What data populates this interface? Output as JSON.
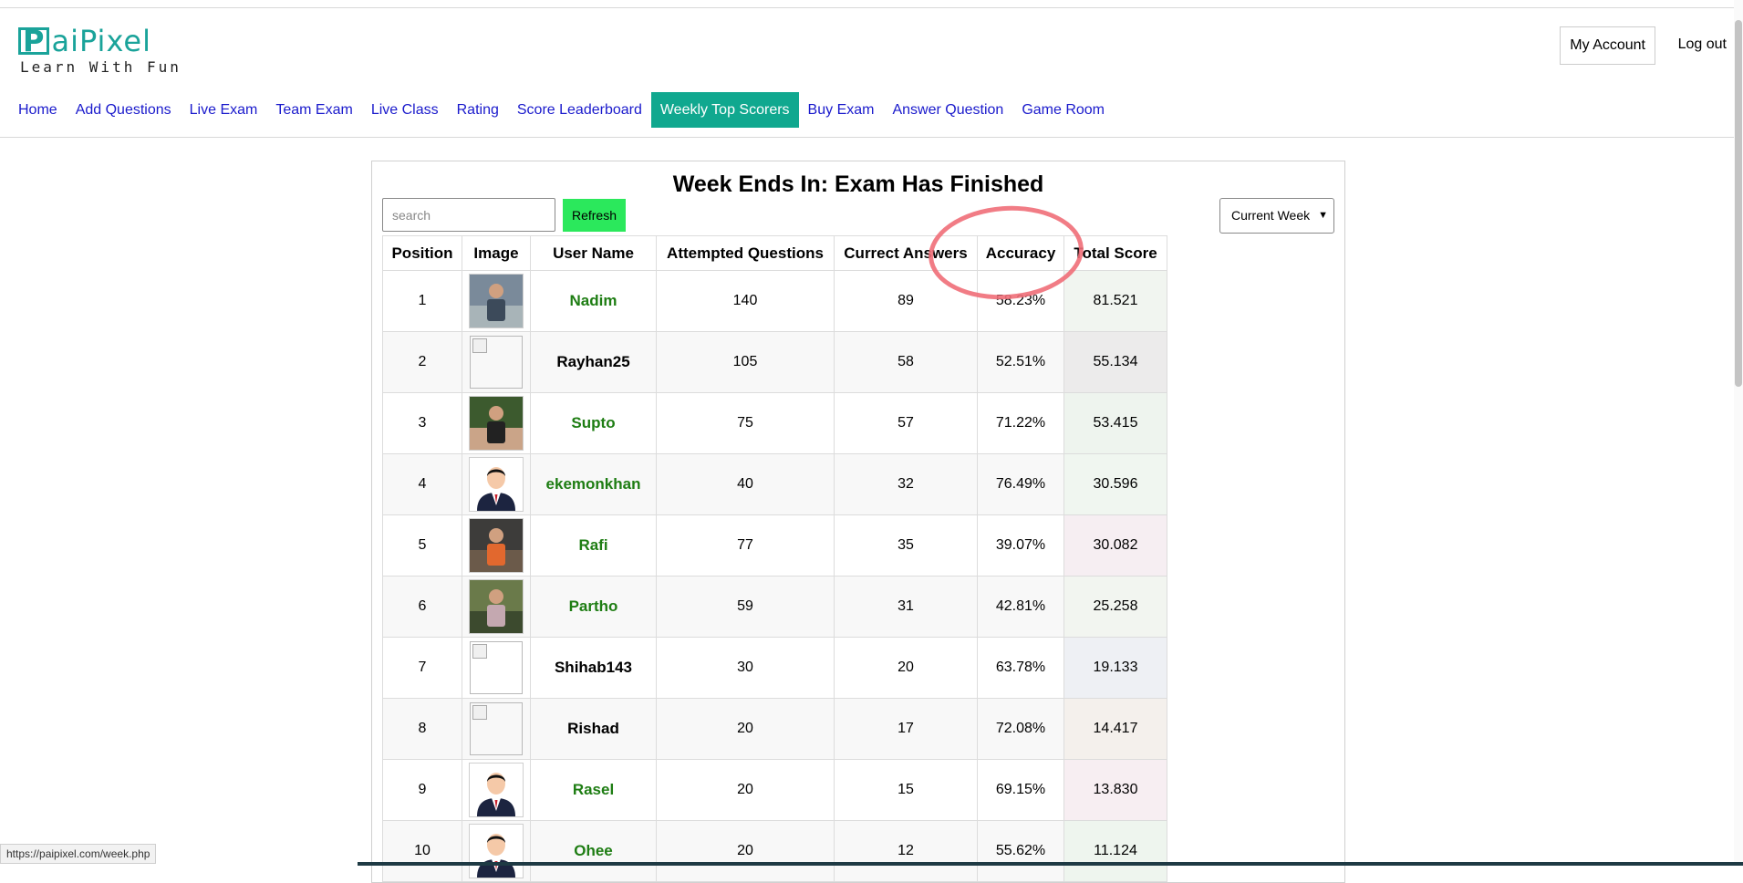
{
  "logo": {
    "letter": "P",
    "word": "aiPixel",
    "tagline": "Learn With Fun"
  },
  "header": {
    "my_account": "My Account",
    "logout": "Log out"
  },
  "nav": [
    {
      "label": "Home"
    },
    {
      "label": "Add Questions"
    },
    {
      "label": "Live Exam"
    },
    {
      "label": "Team Exam"
    },
    {
      "label": "Live Class"
    },
    {
      "label": "Rating"
    },
    {
      "label": "Score Leaderboard"
    },
    {
      "label": "Weekly Top Scorers",
      "active": true
    },
    {
      "label": "Buy Exam"
    },
    {
      "label": "Answer Question"
    },
    {
      "label": "Game Room"
    }
  ],
  "panel": {
    "title": "Week Ends In: Exam Has Finished",
    "search_placeholder": "search",
    "refresh_label": "Refresh",
    "week_select": "Current Week"
  },
  "table": {
    "headers": [
      "Position",
      "Image",
      "User Name",
      "Attempted Questions",
      "Currect Answers",
      "Accuracy",
      "Total Score"
    ],
    "rows": [
      {
        "position": "1",
        "image": "photo",
        "user": "Nadim",
        "green": true,
        "attempted": "140",
        "correct": "89",
        "accuracy": "58.23%",
        "score": "81.521",
        "tint": "#f1f5f0"
      },
      {
        "position": "2",
        "image": "broken",
        "user": "Rayhan25",
        "green": false,
        "attempted": "105",
        "correct": "58",
        "accuracy": "52.51%",
        "score": "55.134",
        "tint": "#ecebeb"
      },
      {
        "position": "3",
        "image": "photo",
        "user": "Supto",
        "green": true,
        "attempted": "75",
        "correct": "57",
        "accuracy": "71.22%",
        "score": "53.415",
        "tint": "#eef4ee"
      },
      {
        "position": "4",
        "image": "avatar",
        "user": "ekemonkhan",
        "green": true,
        "attempted": "40",
        "correct": "32",
        "accuracy": "76.49%",
        "score": "30.596",
        "tint": "#f0f6f0"
      },
      {
        "position": "5",
        "image": "photo",
        "user": "Rafi",
        "green": true,
        "attempted": "77",
        "correct": "35",
        "accuracy": "39.07%",
        "score": "30.082",
        "tint": "#f6eef2"
      },
      {
        "position": "6",
        "image": "photo",
        "user": "Partho",
        "green": true,
        "attempted": "59",
        "correct": "31",
        "accuracy": "42.81%",
        "score": "25.258",
        "tint": "#f2f5f0"
      },
      {
        "position": "7",
        "image": "broken",
        "user": "Shihab143",
        "green": false,
        "attempted": "30",
        "correct": "20",
        "accuracy": "63.78%",
        "score": "19.133",
        "tint": "#eef0f4"
      },
      {
        "position": "8",
        "image": "broken",
        "user": "Rishad",
        "green": false,
        "attempted": "20",
        "correct": "17",
        "accuracy": "72.08%",
        "score": "14.417",
        "tint": "#f4f0ec"
      },
      {
        "position": "9",
        "image": "avatar",
        "user": "Rasel",
        "green": true,
        "attempted": "20",
        "correct": "15",
        "accuracy": "69.15%",
        "score": "13.830",
        "tint": "#f7eef2"
      },
      {
        "position": "10",
        "image": "avatar",
        "user": "Ohee",
        "green": true,
        "attempted": "20",
        "correct": "12",
        "accuracy": "55.62%",
        "score": "11.124",
        "tint": "#eef5ee"
      }
    ]
  },
  "status_url": "https://paipixel.com/week.php",
  "colors": {
    "brand": "#1aa39a",
    "nav_active": "#10a88f",
    "refresh": "#2be85c",
    "username_green": "#1e7d13",
    "annotation": "#f06e78"
  }
}
